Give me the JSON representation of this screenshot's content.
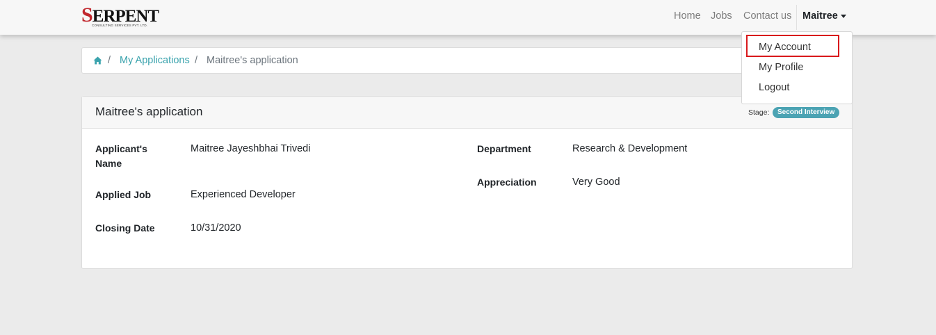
{
  "navbar": {
    "logo": {
      "name": "SERPENT",
      "subtitle": "CONSULTING SERVICES PVT. LTD."
    },
    "links": {
      "home": "Home",
      "jobs": "Jobs",
      "contact": "Contact us"
    },
    "user": "Maitree"
  },
  "dropdown": {
    "items": {
      "account": "My Account",
      "profile": "My Profile",
      "logout": "Logout"
    },
    "highlight_color": "#d9191c"
  },
  "breadcrumb": {
    "home_icon": "home-icon",
    "separator": "/",
    "link": "My Applications",
    "current": "Maitree's application"
  },
  "card": {
    "title": "Maitree's application",
    "stage_label": "Stage:",
    "stage_badge": "Second Interview",
    "fields": {
      "applicant_name_label": "Applicant's Name",
      "applicant_name_value": "Maitree Jayeshbhai Trivedi",
      "applied_job_label": "Applied Job",
      "applied_job_value": "Experienced Developer",
      "closing_date_label": "Closing Date",
      "closing_date_value": "10/31/2020",
      "department_label": "Department",
      "department_value": "Research & Development",
      "appreciation_label": "Appreciation",
      "appreciation_value": "Very Good"
    }
  },
  "colors": {
    "accent": "#3aa3ad",
    "badge": "#4ba3b3",
    "background": "#ebebeb"
  }
}
